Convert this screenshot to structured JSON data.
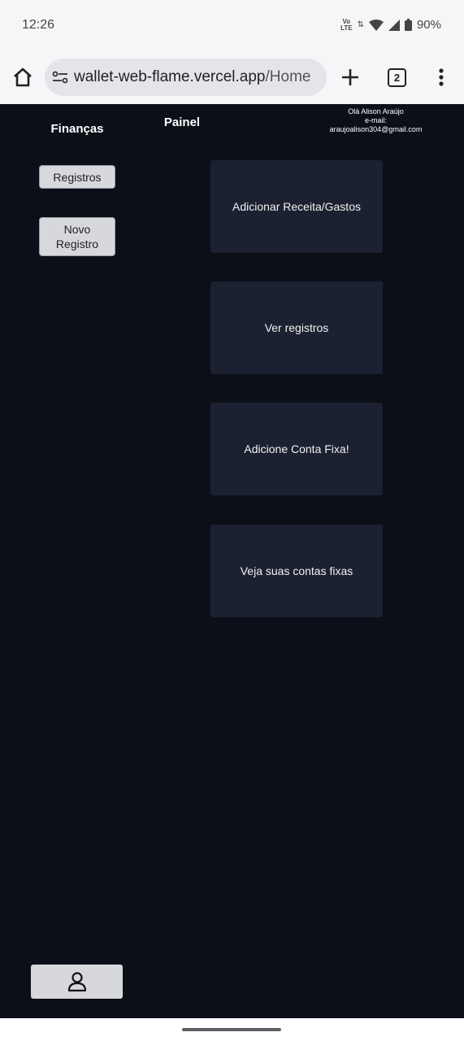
{
  "status_bar": {
    "time": "12:26",
    "volte_top": "Vo",
    "volte_bottom": "LTE",
    "battery": "90%"
  },
  "browser": {
    "url_host": "wallet-web-flame.vercel.app",
    "url_path": "/Home",
    "tab_count": "2"
  },
  "app": {
    "brand": "Finanças",
    "page_title": "Painel",
    "user": {
      "greeting": "Olá Alison Araújo",
      "email_label": "e-mail:",
      "email": "araujoalison304@gmail.com"
    },
    "sidebar": {
      "registros_label": "Registros",
      "novo_registro_label": "Novo Registro"
    },
    "cards": [
      {
        "label": "Adicionar Receita/Gastos"
      },
      {
        "label": "Ver registros"
      },
      {
        "label": "Adicione Conta Fixa!"
      },
      {
        "label": "Veja suas contas fixas"
      }
    ]
  },
  "icons": {
    "home": "home-icon",
    "tune": "site-settings-icon",
    "plus": "new-tab-icon",
    "menu": "more-vert-icon",
    "profile": "user-icon",
    "wifi": "wifi-icon",
    "signal": "signal-icon",
    "battery": "battery-icon"
  },
  "colors": {
    "background": "#0c0f17",
    "card": "#1b2131",
    "button": "#d7d8dc"
  }
}
